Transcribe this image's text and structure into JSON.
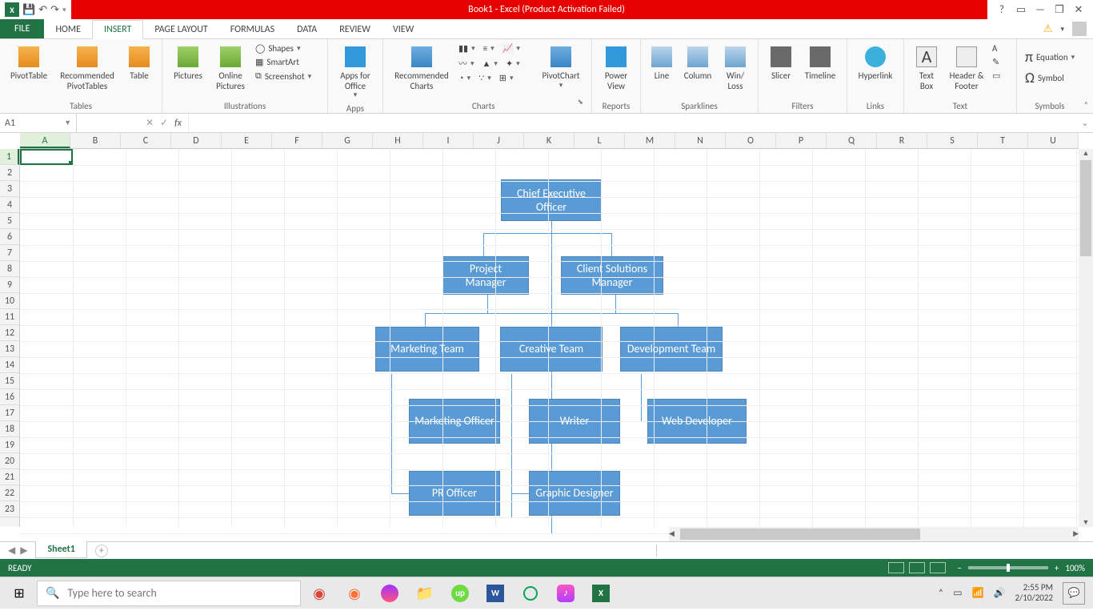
{
  "titlebar": {
    "title": "Book1 - Excel (Product Activation Failed)"
  },
  "tabs": {
    "file": "FILE",
    "home": "HOME",
    "insert": "INSERT",
    "pagelayout": "PAGE LAYOUT",
    "formulas": "FORMULAS",
    "data": "DATA",
    "review": "REVIEW",
    "view": "VIEW"
  },
  "ribbon": {
    "tables": {
      "pivottable": "PivotTable",
      "recommended": "Recommended PivotTables",
      "table": "Table",
      "label": "Tables"
    },
    "illustrations": {
      "pictures": "Pictures",
      "online": "Online Pictures",
      "shapes": "Shapes",
      "smartart": "SmartArt",
      "screenshot": "Screenshot",
      "label": "Illustrations"
    },
    "apps": {
      "apps": "Apps for Office",
      "label": "Apps"
    },
    "charts": {
      "recommended": "Recommended Charts",
      "pivotchart": "PivotChart",
      "label": "Charts"
    },
    "reports": {
      "power": "Power View",
      "label": "Reports"
    },
    "sparklines": {
      "line": "Line",
      "column": "Column",
      "winloss": "Win/ Loss",
      "label": "Sparklines"
    },
    "filters": {
      "slicer": "Slicer",
      "timeline": "Timeline",
      "label": "Filters"
    },
    "links": {
      "hyperlink": "Hyperlink",
      "label": "Links"
    },
    "text": {
      "textbox": "Text Box",
      "header": "Header & Footer",
      "label": "Text"
    },
    "symbols": {
      "equation": "Equation",
      "symbol": "Symbol",
      "label": "Symbols"
    }
  },
  "formula": {
    "cellref": "A1",
    "fx": "fx",
    "cancel": "✕",
    "enter": "✓"
  },
  "grid": {
    "columns": [
      "A",
      "B",
      "C",
      "D",
      "E",
      "F",
      "G",
      "H",
      "I",
      "J",
      "K",
      "L",
      "M",
      "N",
      "O",
      "P",
      "Q",
      "R",
      "S",
      "T",
      "U"
    ],
    "rows": [
      "1",
      "2",
      "3",
      "4",
      "5",
      "6",
      "7",
      "8",
      "9",
      "10",
      "11",
      "12",
      "13",
      "14",
      "15",
      "16",
      "17",
      "18",
      "19",
      "20",
      "21",
      "22",
      "23"
    ]
  },
  "chart_data": {
    "type": "orgchart",
    "nodes": [
      {
        "id": "ceo",
        "label": "Chief Executive Officer",
        "parent": null
      },
      {
        "id": "pm",
        "label": "Project Manager",
        "parent": "ceo"
      },
      {
        "id": "csm",
        "label": "Client Solutions Manager",
        "parent": "ceo"
      },
      {
        "id": "mkt",
        "label": "Marketing Team",
        "parent": "pm"
      },
      {
        "id": "crt",
        "label": "Creative Team",
        "parent": "pm"
      },
      {
        "id": "dev",
        "label": "Development Team",
        "parent": "csm"
      },
      {
        "id": "mo",
        "label": "Marketing Officer",
        "parent": "mkt"
      },
      {
        "id": "wr",
        "label": "Writer",
        "parent": "crt"
      },
      {
        "id": "wd",
        "label": "Web Developer",
        "parent": "dev"
      },
      {
        "id": "pr",
        "label": "PR Officer",
        "parent": "mkt"
      },
      {
        "id": "gd",
        "label": "Graphic Designer",
        "parent": "crt"
      }
    ],
    "fill_color": "#5b9bd5"
  },
  "sheet": {
    "name": "Sheet1"
  },
  "status": {
    "ready": "READY",
    "zoom": "100%"
  },
  "taskbar": {
    "search_placeholder": "Type here to search",
    "time": "2:55 PM",
    "date": "2/10/2022"
  }
}
